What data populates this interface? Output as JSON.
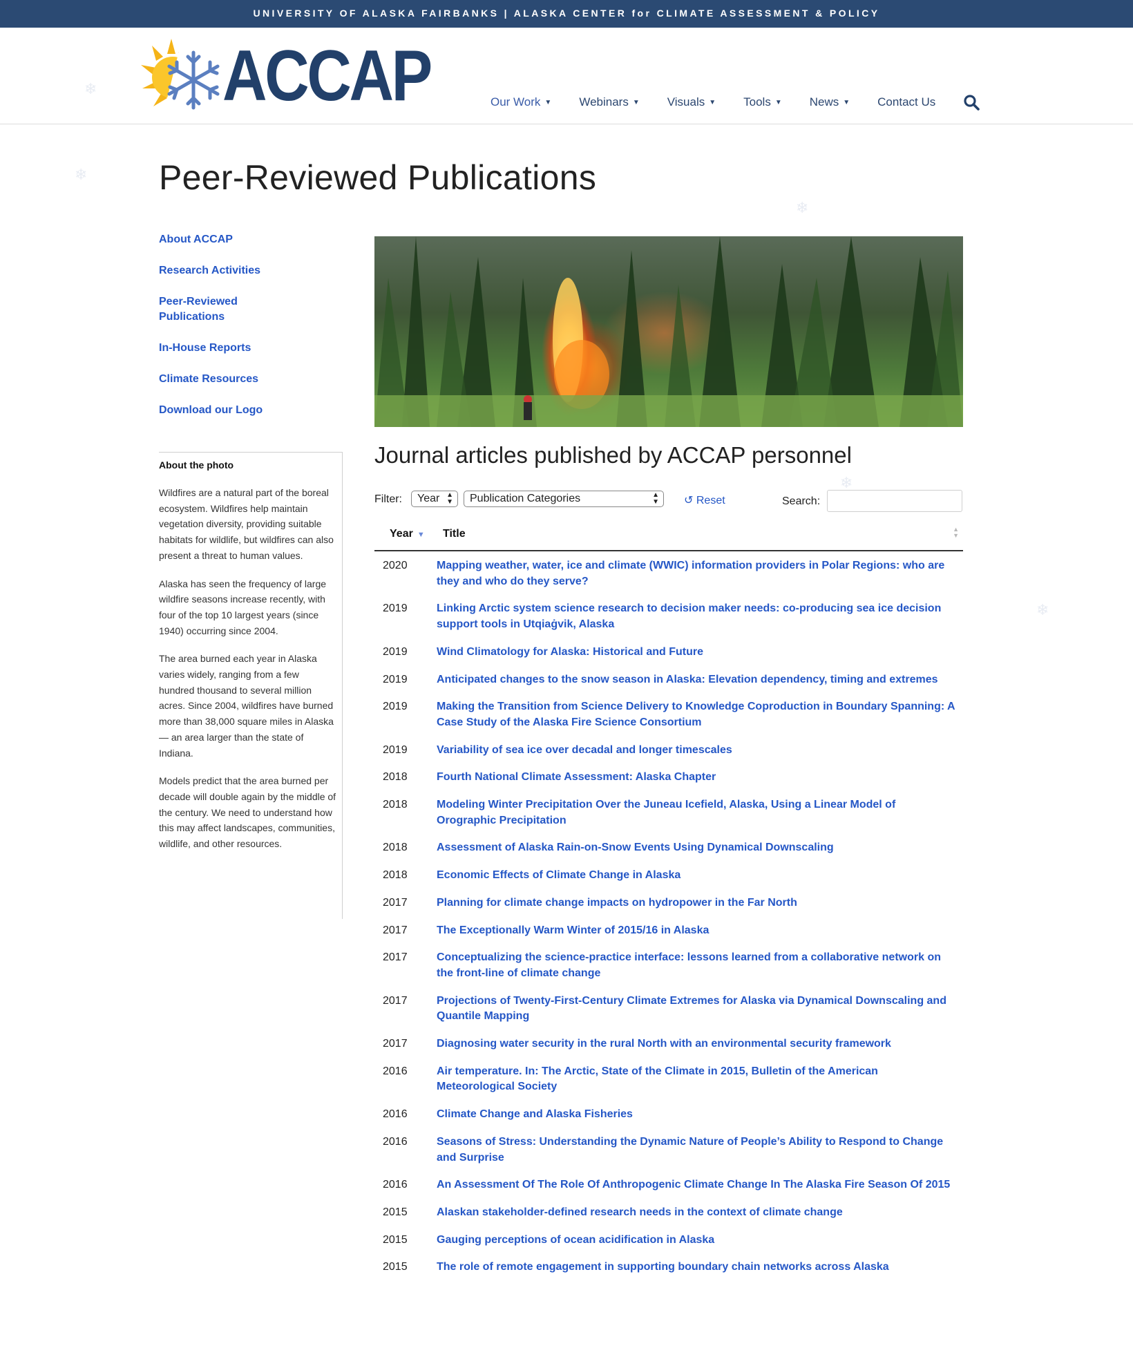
{
  "topbar": {
    "text": "UNIVERSITY OF ALASKA FAIRBANKS | ALASKA CENTER for CLIMATE ASSESSMENT & POLICY"
  },
  "logo": {
    "text": "ACCAP",
    "color": "#22406a"
  },
  "nav": {
    "items": [
      {
        "label": "Our Work",
        "dropdown": true
      },
      {
        "label": "Webinars",
        "dropdown": true
      },
      {
        "label": "Visuals",
        "dropdown": true
      },
      {
        "label": "Tools",
        "dropdown": true
      },
      {
        "label": "News",
        "dropdown": true
      },
      {
        "label": "Contact Us",
        "dropdown": false
      }
    ],
    "search_icon": "search-icon"
  },
  "page": {
    "title": "Peer-Reviewed Publications"
  },
  "sidebar": {
    "links": [
      "About ACCAP",
      "Research Activities",
      "Peer-Reviewed Publications",
      "In-House Reports",
      "Climate Resources",
      "Download our Logo"
    ],
    "photo_box": {
      "heading": "About the photo",
      "paragraphs": [
        "Wildfires are a natural part of the boreal ecosystem. Wildfires help maintain vegetation diversity, providing suitable habitats for wildlife, but wildfires can also present a threat to human values.",
        "Alaska has seen the frequency of large wildfire seasons increase recently, with four of the top 10 largest years (since 1940) occurring since 2004.",
        "The area burned each year in Alaska varies widely, ranging from a few hundred thousand to several million acres. Since 2004, wildfires have burned more than 38,000 square miles in Alaska — an area larger than the state of Indiana.",
        "Models predict that the area burned per decade will double again by the middle of the century. We need to understand how this may affect landscapes, communities, wildlife, and other resources."
      ]
    }
  },
  "main": {
    "section_title": "Journal articles published by ACCAP personnel",
    "filter": {
      "label": "Filter:",
      "year_select": "Year",
      "category_select": "Publication Categories",
      "reset_label": "Reset",
      "search_label": "Search:",
      "search_value": ""
    },
    "table": {
      "headers": {
        "year": "Year",
        "title": "Title"
      },
      "rows": [
        {
          "year": "2020",
          "title": "Mapping weather, water, ice and climate (WWIC) information providers in Polar Regions: who are they and who do they serve?"
        },
        {
          "year": "2019",
          "title": "Linking Arctic system science research to decision maker needs: co-producing sea ice decision support tools in Utqiaġvik, Alaska"
        },
        {
          "year": "2019",
          "title": "Wind Climatology for Alaska: Historical and Future"
        },
        {
          "year": "2019",
          "title": "Anticipated changes to the snow season in Alaska: Elevation dependency, timing and extremes"
        },
        {
          "year": "2019",
          "title": "Making the Transition from Science Delivery to Knowledge Coproduction in Boundary Spanning: A Case Study of the Alaska Fire Science Consortium"
        },
        {
          "year": "2019",
          "title": "Variability of sea ice over decadal and longer timescales"
        },
        {
          "year": "2018",
          "title": "Fourth National Climate Assessment: Alaska Chapter"
        },
        {
          "year": "2018",
          "title": "Modeling Winter Precipitation Over the Juneau Icefield, Alaska, Using a Linear Model of Orographic Precipitation"
        },
        {
          "year": "2018",
          "title": "Assessment of Alaska Rain-on-Snow Events Using Dynamical Downscaling"
        },
        {
          "year": "2018",
          "title": "Economic Effects of Climate Change in Alaska"
        },
        {
          "year": "2017",
          "title": "Planning for climate change impacts on hydropower in the Far North"
        },
        {
          "year": "2017",
          "title": "The Exceptionally Warm Winter of 2015/16 in Alaska"
        },
        {
          "year": "2017",
          "title": "Conceptualizing the science-practice interface: lessons learned from a collaborative network on the front-line of climate change"
        },
        {
          "year": "2017",
          "title": "Projections of Twenty-First-Century Climate Extremes for Alaska via Dynamical Downscaling and Quantile Mapping"
        },
        {
          "year": "2017",
          "title": "Diagnosing water security in the rural North with an environmental security framework"
        },
        {
          "year": "2016",
          "title": "Air temperature. In: The Arctic, State of the Climate in 2015, Bulletin of the American Meteorological Society"
        },
        {
          "year": "2016",
          "title": "Climate Change and Alaska Fisheries"
        },
        {
          "year": "2016",
          "title": "Seasons of Stress: Understanding the Dynamic Nature of People’s Ability to Respond to Change and Surprise"
        },
        {
          "year": "2016",
          "title": "An Assessment Of The Role Of Anthropogenic Climate Change In The Alaska Fire Season Of 2015"
        },
        {
          "year": "2015",
          "title": "Alaskan stakeholder-defined research needs in the context of climate change"
        },
        {
          "year": "2015",
          "title": "Gauging perceptions of ocean acidification in Alaska"
        },
        {
          "year": "2015",
          "title": "The role of remote engagement in supporting boundary chain networks across Alaska"
        }
      ]
    }
  },
  "colors": {
    "topbar": "#2b4a73",
    "link": "#2557c6",
    "logo": "#22406a"
  }
}
